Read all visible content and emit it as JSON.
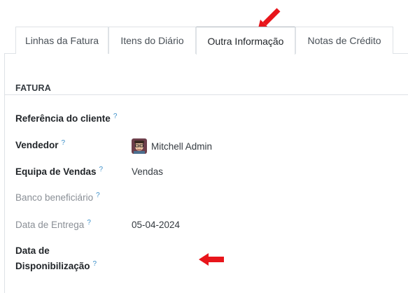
{
  "tabs": [
    {
      "label": "Linhas da Fatura",
      "active": false
    },
    {
      "label": "Itens do Diário",
      "active": false
    },
    {
      "label": "Outra Informação",
      "active": true
    },
    {
      "label": "Notas de Crédito",
      "active": false
    }
  ],
  "section": {
    "title": "FATURA"
  },
  "help_mark": "?",
  "fields": {
    "customer_reference": {
      "label": "Referência do cliente",
      "value": ""
    },
    "salesperson": {
      "label": "Vendedor",
      "value": "Mitchell Admin"
    },
    "sales_team": {
      "label": "Equipa de Vendas",
      "value": "Vendas"
    },
    "beneficiary_bank": {
      "label": "Banco beneficiário",
      "value": ""
    },
    "delivery_date": {
      "label": "Data de Entrega",
      "value": "05-04-2024"
    },
    "availability_date": {
      "label_line1": "Data de",
      "label_line2": "Disponibilização",
      "value": ""
    }
  },
  "colors": {
    "annotation_arrow": "#e8151b",
    "help_mark": "#3b8fc9",
    "muted_label": "#8a8f96"
  },
  "icons": {
    "avatar": "user-avatar-icon",
    "arrow_tab": "red-arrow-annotation-icon",
    "arrow_field": "red-arrow-annotation-icon"
  }
}
